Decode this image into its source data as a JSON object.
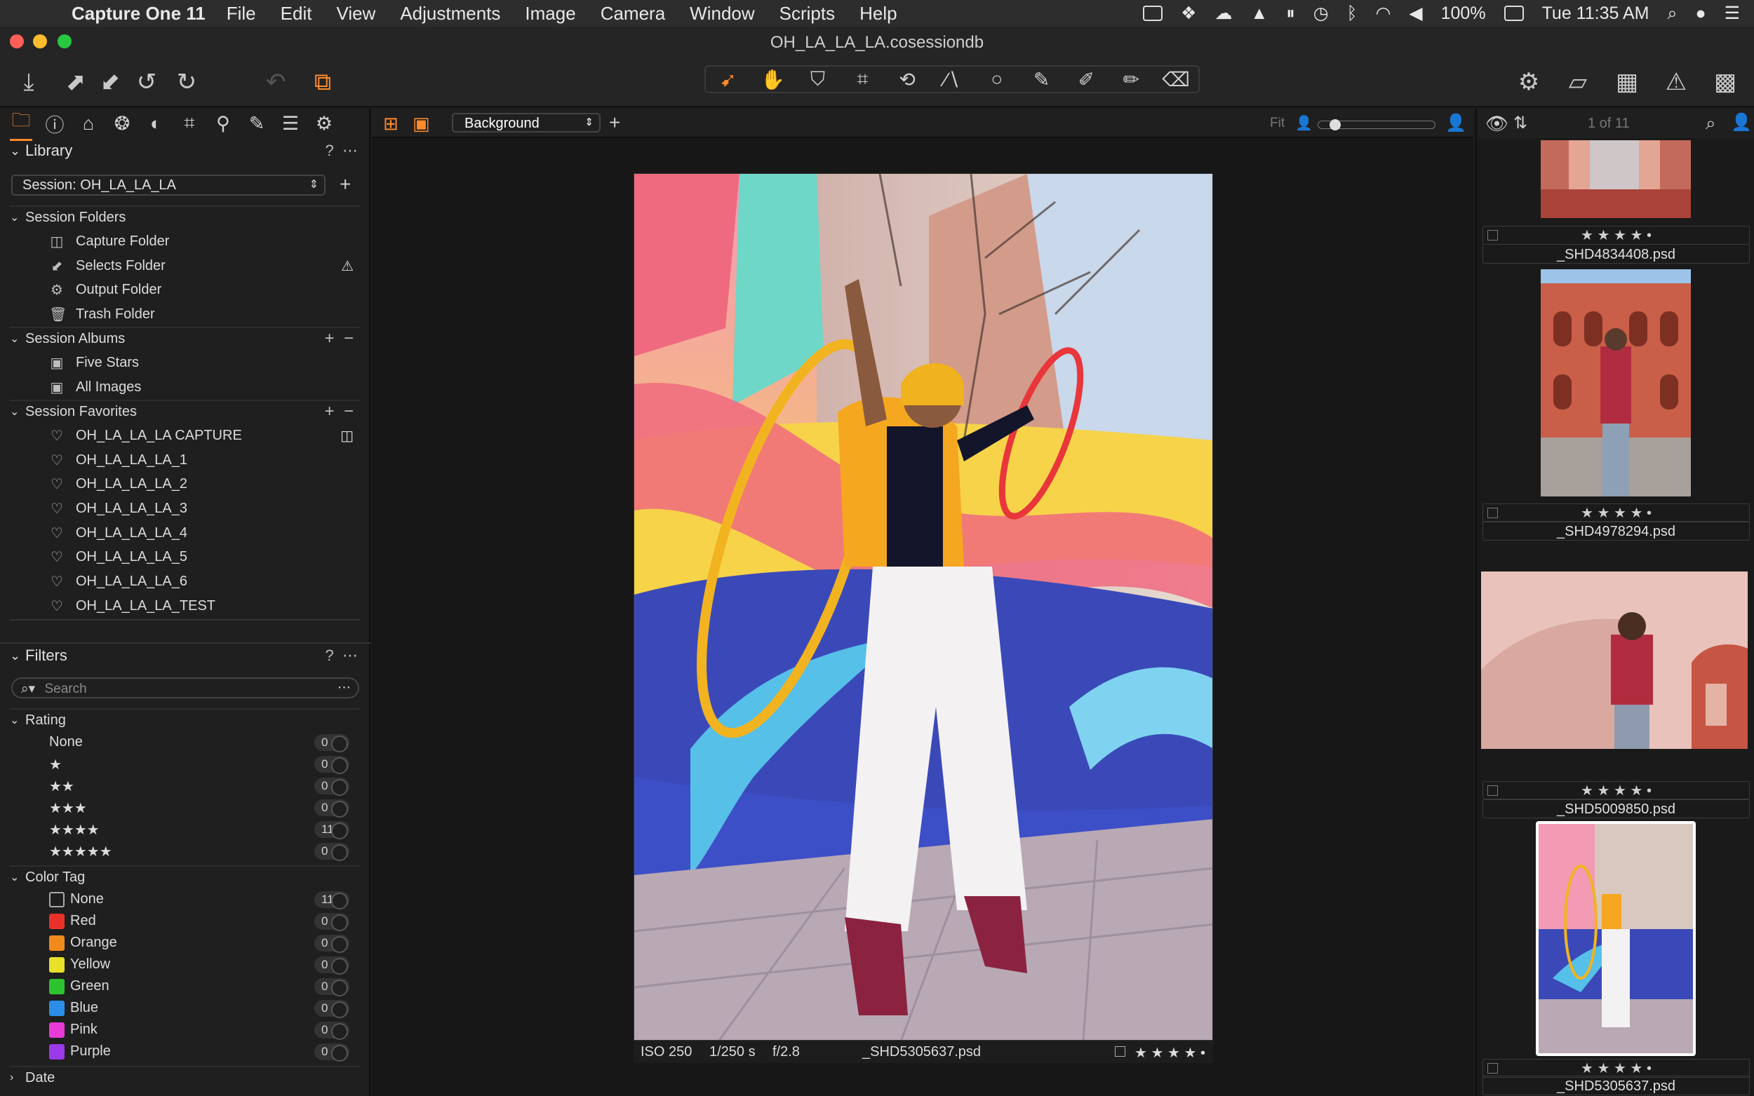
{
  "menubar": {
    "app_name": "Capture One 11",
    "items": [
      "File",
      "Edit",
      "View",
      "Adjustments",
      "Image",
      "Camera",
      "Window",
      "Scripts",
      "Help"
    ],
    "battery": "100%",
    "clock": "Tue 11:35 AM"
  },
  "window": {
    "title": "OH_LA_LA_LA.cosessiondb"
  },
  "library": {
    "header": "Library",
    "help": "?",
    "session_select": "Session: OH_LA_LA_LA",
    "session_folders": {
      "label": "Session Folders",
      "items": [
        "Capture Folder",
        "Selects Folder",
        "Output Folder",
        "Trash Folder"
      ]
    },
    "session_albums": {
      "label": "Session Albums",
      "items": [
        "Five Stars",
        "All Images"
      ]
    },
    "session_favorites": {
      "label": "Session Favorites",
      "items": [
        "OH_LA_LA_LA CAPTURE",
        "OH_LA_LA_LA_1",
        "OH_LA_LA_LA_2",
        "OH_LA_LA_LA_3",
        "OH_LA_LA_LA_4",
        "OH_LA_LA_LA_5",
        "OH_LA_LA_LA_6",
        "OH_LA_LA_LA_TEST"
      ]
    }
  },
  "filters": {
    "header": "Filters",
    "help": "?",
    "search_placeholder": "Search",
    "rating": {
      "label": "Rating",
      "rows": [
        {
          "label": "None",
          "count": "0"
        },
        {
          "label": "★",
          "count": "0"
        },
        {
          "label": "★★",
          "count": "0"
        },
        {
          "label": "★★★",
          "count": "0"
        },
        {
          "label": "★★★★",
          "count": "11"
        },
        {
          "label": "★★★★★",
          "count": "0"
        }
      ]
    },
    "color_tag": {
      "label": "Color Tag",
      "rows": [
        {
          "label": "None",
          "count": "11",
          "color": ""
        },
        {
          "label": "Red",
          "count": "0",
          "color": "#e8312a"
        },
        {
          "label": "Orange",
          "count": "0",
          "color": "#f08a1c"
        },
        {
          "label": "Yellow",
          "count": "0",
          "color": "#e9e02a"
        },
        {
          "label": "Green",
          "count": "0",
          "color": "#2ec32e"
        },
        {
          "label": "Blue",
          "count": "0",
          "color": "#2a8ee8"
        },
        {
          "label": "Pink",
          "count": "0",
          "color": "#e83ad6"
        },
        {
          "label": "Purple",
          "count": "0",
          "color": "#9a3ae8"
        }
      ]
    },
    "date_label": "Date"
  },
  "viewer": {
    "style_select": "Background",
    "fit_label": "Fit",
    "caption": {
      "iso": "ISO 250",
      "shutter": "1/250 s",
      "aperture": "f/2.8",
      "filename": "_SHD5305637.psd",
      "rating": "★ ★ ★ ★ •"
    }
  },
  "browser": {
    "counter": "1 of 11",
    "thumbs": [
      {
        "rating": "★ ★ ★ ★ •",
        "name": "_SHD4834408.psd"
      },
      {
        "rating": "★ ★ ★ ★ •",
        "name": "_SHD4978294.psd"
      },
      {
        "rating": "★ ★ ★ ★ •",
        "name": "_SHD5009850.psd"
      },
      {
        "rating": "★ ★ ★ ★ •",
        "name": "_SHD5305637.psd"
      }
    ]
  },
  "colors": {
    "accent": "#ff8a2a",
    "panel": "#1f1f1f",
    "viewer": "#171717"
  }
}
